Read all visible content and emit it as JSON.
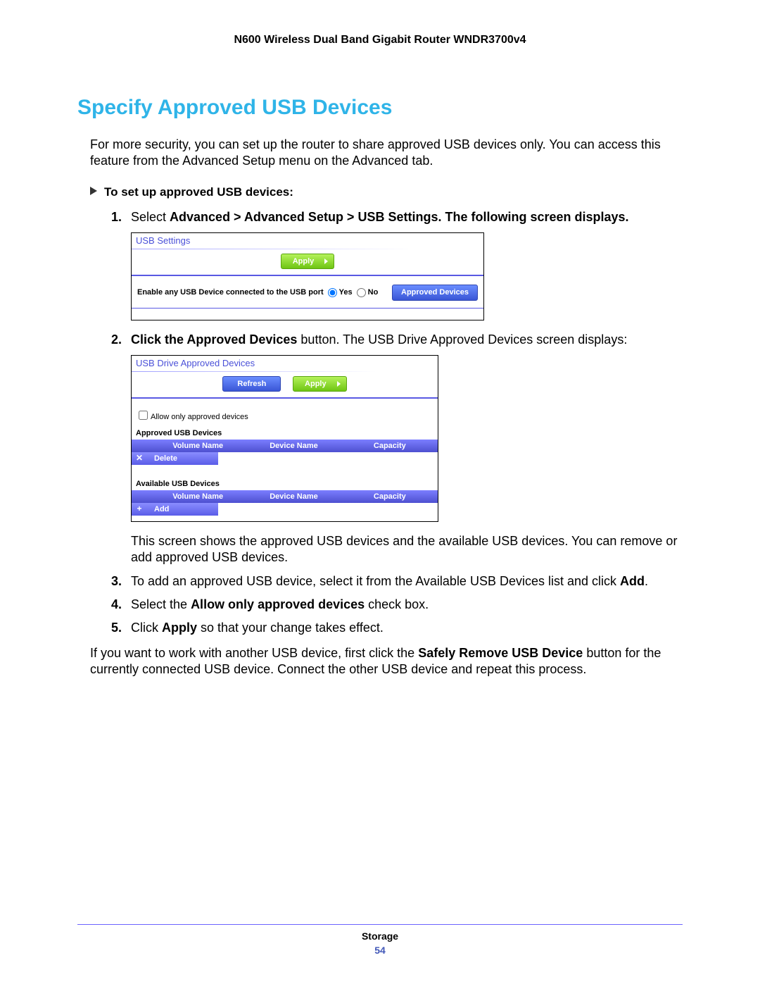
{
  "header": {
    "product": "N600 Wireless Dual Band Gigabit Router WNDR3700v4"
  },
  "title": "Specify Approved USB Devices",
  "intro": "For more security, you can set up the router to share approved USB devices only. You can access this feature from the Advanced Setup menu on the Advanced tab.",
  "task_heading": "To set up approved USB devices:",
  "steps": {
    "s1": {
      "num": "1.",
      "pre": "Select ",
      "bold": "Advanced > Advanced Setup > USB Settings. The following screen displays."
    },
    "s2": {
      "num": "2.",
      "bold": "Click the Approved Devices",
      "post": " button. The USB Drive Approved Devices screen displays:"
    },
    "s2_explain": "This screen shows the approved USB devices and the available USB devices. You can remove or add approved USB devices.",
    "s3": {
      "num": "3.",
      "text_a": "To add an approved USB device, select it from the Available USB Devices list and click ",
      "bold": "Add",
      "text_b": "."
    },
    "s4": {
      "num": "4.",
      "pre": "Select the ",
      "bold": "Allow only approved devices",
      "post": " check box."
    },
    "s5": {
      "num": "5.",
      "pre": "Click ",
      "bold": "Apply",
      "post": " so that your change takes effect."
    }
  },
  "closing": {
    "a": "If you want to work with another USB device, first click the ",
    "bold": "Safely Remove USB Device",
    "b": " button for the currently connected USB device. Connect the other USB device and repeat this process."
  },
  "panel1": {
    "title": "USB Settings",
    "apply": "Apply",
    "enable_label": "Enable any USB Device connected to the USB port",
    "yes": "Yes",
    "no": "No",
    "approved_btn": "Approved Devices"
  },
  "panel2": {
    "title": "USB Drive Approved Devices",
    "refresh": "Refresh",
    "apply": "Apply",
    "allow_label": "Allow only approved devices",
    "approved_heading": "Approved USB Devices",
    "available_heading": "Available USB Devices",
    "cols": {
      "vol": "Volume Name",
      "dev": "Device Name",
      "cap": "Capacity"
    },
    "delete": "Delete",
    "add": "Add"
  },
  "footer": {
    "section": "Storage",
    "page": "54"
  }
}
